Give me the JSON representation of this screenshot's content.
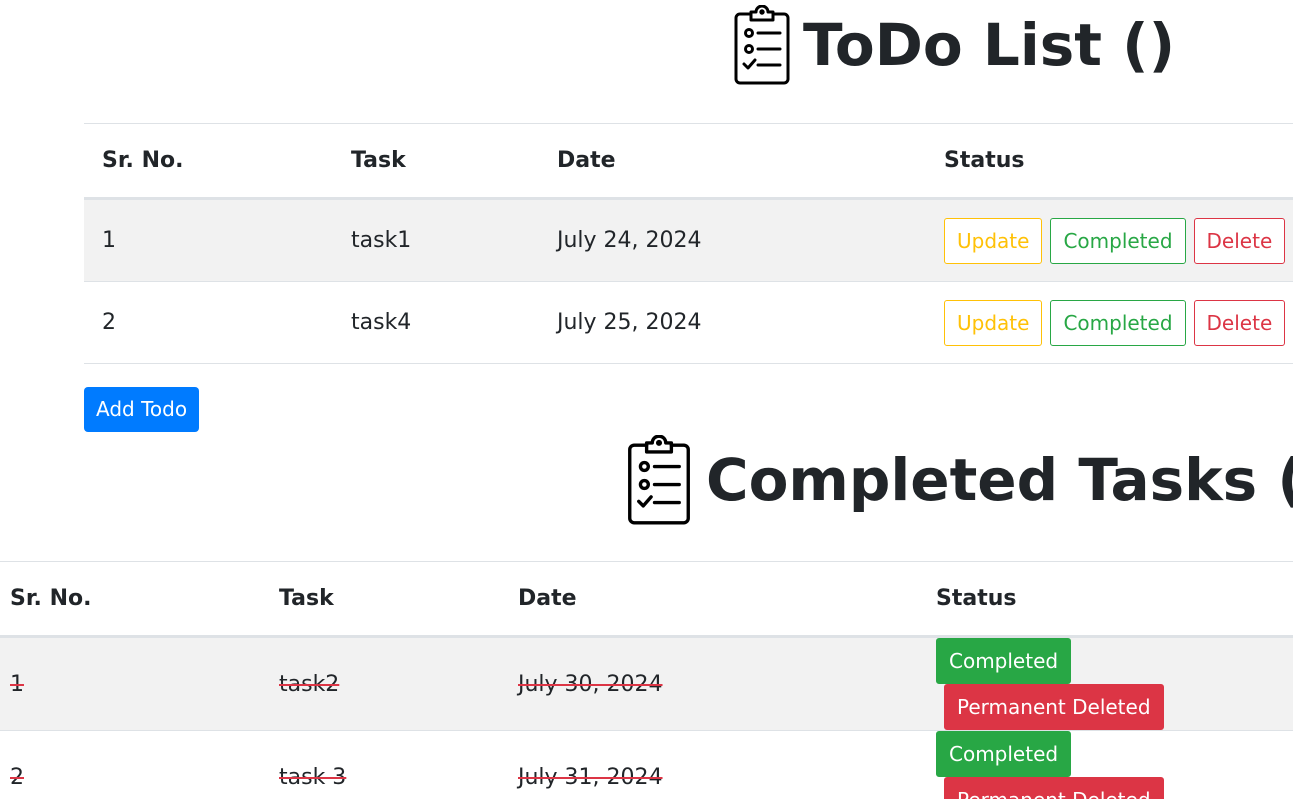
{
  "todo": {
    "title": "ToDo List ()",
    "headers": [
      "Sr. No.",
      "Task",
      "Date",
      "Status"
    ],
    "rows": [
      {
        "sr": "1",
        "task": "task1",
        "date": "July 24, 2024"
      },
      {
        "sr": "2",
        "task": "task4",
        "date": "July 25, 2024"
      }
    ],
    "actions": {
      "update": "Update",
      "complete": "Completed",
      "delete": "Delete"
    },
    "add_label": "Add Todo"
  },
  "completed": {
    "title": "Completed Tasks ()",
    "headers": [
      "Sr. No.",
      "Task",
      "Date",
      "Status"
    ],
    "rows": [
      {
        "sr": "1",
        "task": "task2",
        "date": "July 30, 2024"
      },
      {
        "sr": "2",
        "task": "task 3",
        "date": "July 31, 2024"
      }
    ],
    "actions": {
      "complete": "Completed",
      "delete": "Permanent Deleted"
    }
  },
  "icons": {
    "heading": "clipboard-checklist-icon"
  },
  "colors": {
    "primary": "#007bff",
    "success": "#28a745",
    "warning": "#ffc107",
    "danger": "#dc3545",
    "text": "#212529",
    "stripe": "#f2f2f2"
  }
}
